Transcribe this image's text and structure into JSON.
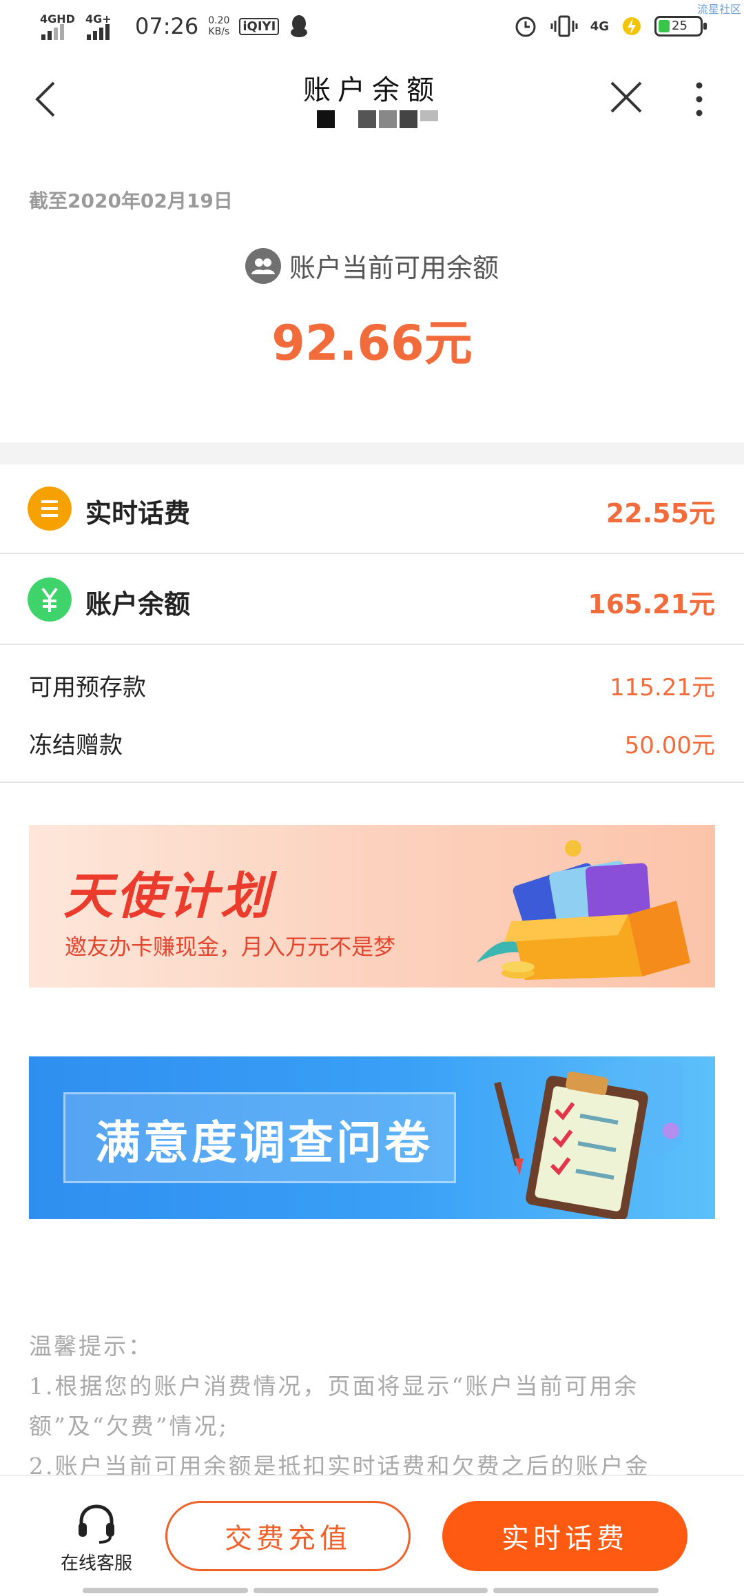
{
  "status_bar": {
    "sim1_label": "4GHD",
    "sim2_label": "4G+",
    "time": "07:26",
    "speed_value": "0.20",
    "speed_unit": "KB/s",
    "app_badge": "iQIYI",
    "right_network": "4G",
    "battery_level": "25",
    "watermark": "流星社区"
  },
  "nav": {
    "title": "账户余额"
  },
  "summary": {
    "as_of": "截至2020年02月19日",
    "available_label": "账户当前可用余额",
    "available_amount": "92.66元"
  },
  "items": [
    {
      "label": "实时话费",
      "value": "22.55元",
      "icon": "list-icon",
      "icon_color": "#f7a100"
    },
    {
      "label": "账户余额",
      "value": "165.21元",
      "icon": "yuan-icon",
      "icon_color": "#3ed36b"
    }
  ],
  "details": [
    {
      "label": "可用预存款",
      "value": "115.21元"
    },
    {
      "label": "冻结赠款",
      "value": "50.00元"
    }
  ],
  "banners": {
    "angel_title": "天使计划",
    "angel_subtitle": "邀友办卡赚现金，月入万元不是梦",
    "survey_title": "满意度调查问卷"
  },
  "tips": {
    "title": "温馨提示：",
    "line1": "1.根据您的账户消费情况，页面将显示“账户当前可用余额”及“欠费”情况;",
    "line2": "2.账户当前可用余额是抵扣实时话费和欠费之后的账户金"
  },
  "bottom": {
    "customer_service": "在线客服",
    "pay_button": "交费充值",
    "realtime_button": "实时话费"
  },
  "colors": {
    "accent": "#f26b3a",
    "button": "#ff5a12"
  }
}
